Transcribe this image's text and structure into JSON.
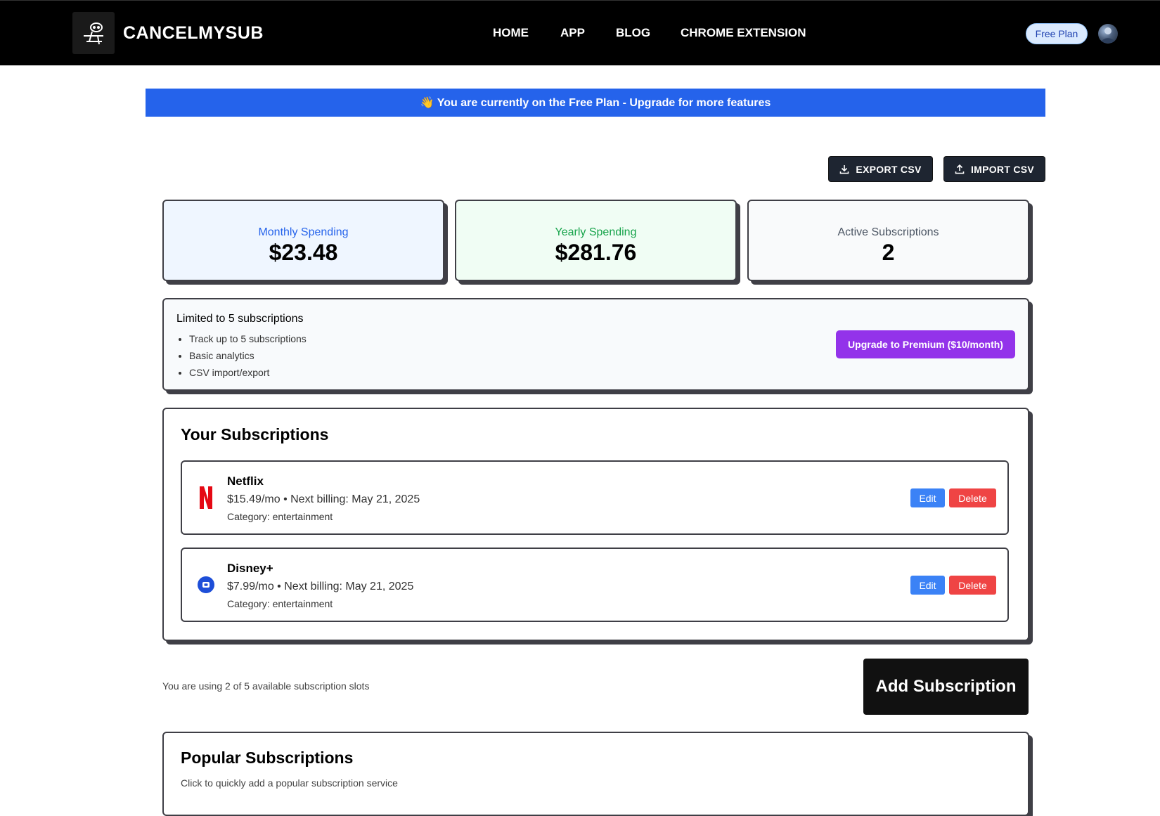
{
  "nav": {
    "brand": "CANCELMYSUB",
    "links": [
      "HOME",
      "APP",
      "BLOG",
      "CHROME EXTENSION"
    ],
    "plan_badge": "Free Plan"
  },
  "banner": {
    "text": "👋 You are currently on the Free Plan - Upgrade for more features"
  },
  "toolbar": {
    "export_label": "EXPORT CSV",
    "import_label": "IMPORT CSV"
  },
  "stats": {
    "monthly": {
      "label": "Monthly Spending",
      "value": "$23.48"
    },
    "yearly": {
      "label": "Yearly Spending",
      "value": "$281.76"
    },
    "active": {
      "label": "Active Subscriptions",
      "value": "2"
    }
  },
  "limits": {
    "title": "Limited to 5 subscriptions",
    "items": [
      "Track up to 5 subscriptions",
      "Basic analytics",
      "CSV import/export"
    ],
    "upgrade_label": "Upgrade to Premium ($10/month)"
  },
  "subscriptions": {
    "title": "Your Subscriptions",
    "items": [
      {
        "name": "Netflix",
        "price": "$15.49/mo",
        "next_billing": "Next billing: May 21, 2025",
        "category": "Category: entertainment",
        "icon": "netflix-icon"
      },
      {
        "name": "Disney+",
        "price": "$7.99/mo",
        "next_billing": "Next billing: May 21, 2025",
        "category": "Category: entertainment",
        "icon": "disney-plus-icon"
      }
    ],
    "edit_label": "Edit",
    "delete_label": "Delete",
    "separator": "•"
  },
  "slots_text": "You are using 2 of 5 available subscription slots",
  "add_label": "Add Subscription",
  "popular": {
    "title": "Popular Subscriptions",
    "subtitle": "Click to quickly add a popular subscription service"
  },
  "colors": {
    "banner": "#2563eb",
    "monthly_bg": "#eff6ff",
    "monthly_text": "#2563eb",
    "yearly_bg": "#f0fdf4",
    "yearly_text": "#16a34a",
    "premium_button": "#9333ea",
    "edit_button": "#3b82f6",
    "delete_button": "#ef4444"
  }
}
